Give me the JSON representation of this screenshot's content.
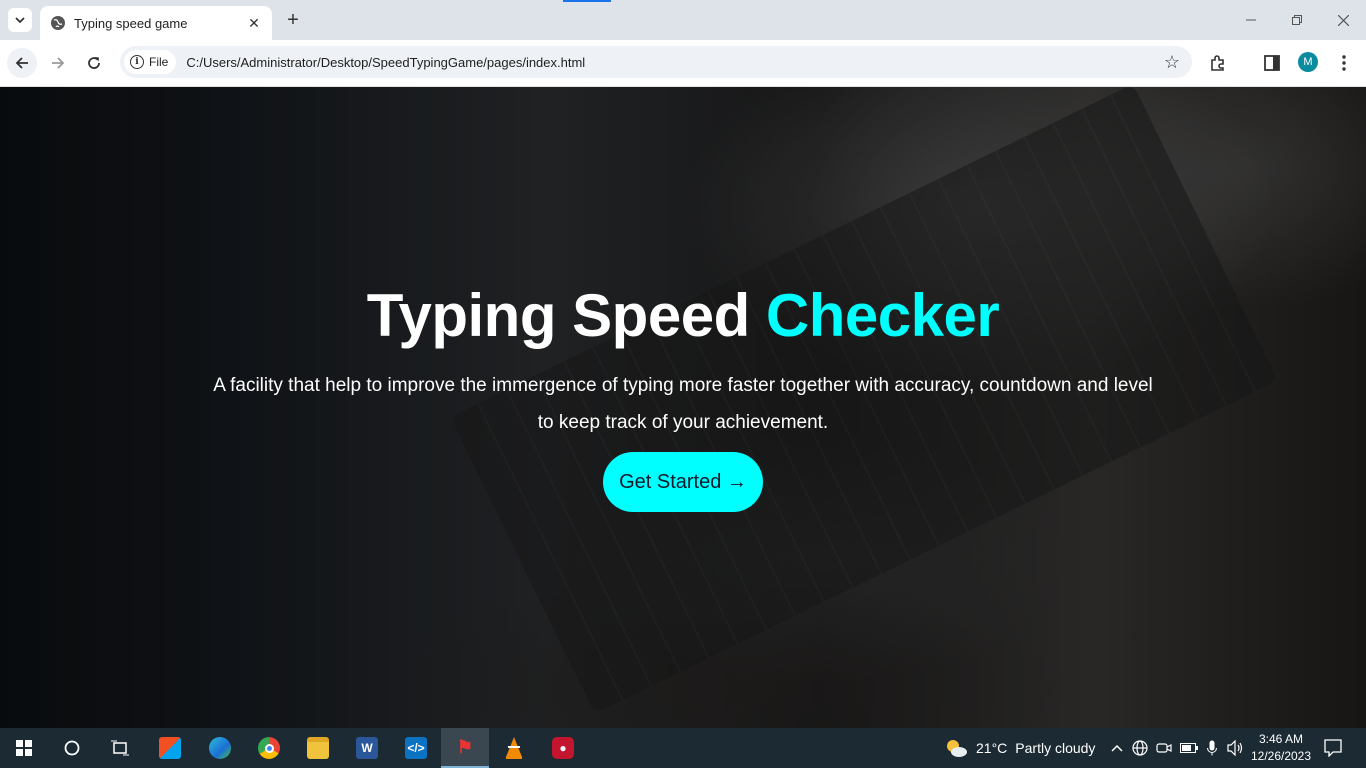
{
  "browser": {
    "tab_title": "Typing speed game",
    "new_tab_label": "+",
    "close_tab_label": "✕",
    "site_chip_label": "File",
    "url": "C:/Users/Administrator/Desktop/SpeedTypingGame/pages/index.html",
    "profile_initial": "M"
  },
  "hero": {
    "title_main": "Typing Speed ",
    "title_accent": "Checker",
    "accent_color": "#00ffff",
    "subtitle": "A facility that help to improve the immergence of typing more faster together with accuracy, countdown and level to keep track of your achievement.",
    "cta_label": "Get Started →"
  },
  "taskbar": {
    "weather_temp": "21°C",
    "weather_desc": "Partly cloudy",
    "time": "3:46 AM",
    "date": "12/26/2023"
  }
}
